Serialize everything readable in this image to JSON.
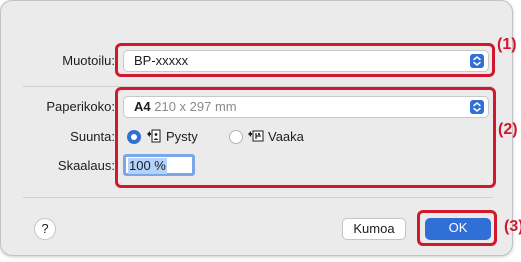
{
  "format": {
    "label": "Muotoilu:",
    "value": "BP-xxxxx"
  },
  "paper": {
    "label": "Paperikoko:",
    "size_name": "A4",
    "size_dims": "210 x 297 mm"
  },
  "orientation": {
    "label": "Suunta:",
    "options": [
      {
        "label": "Pysty",
        "selected": true
      },
      {
        "label": "Vaaka",
        "selected": false
      }
    ]
  },
  "scale": {
    "label": "Skaalaus:",
    "value": "100 %"
  },
  "footer": {
    "help_label": "?",
    "cancel_label": "Kumoa",
    "ok_label": "OK"
  },
  "callouts": [
    "(1)",
    "(2)",
    "(3)"
  ],
  "colors": {
    "accent": "#2f6fd6",
    "highlight_red": "#d0182f",
    "dialog_bg": "#ebebeb"
  }
}
